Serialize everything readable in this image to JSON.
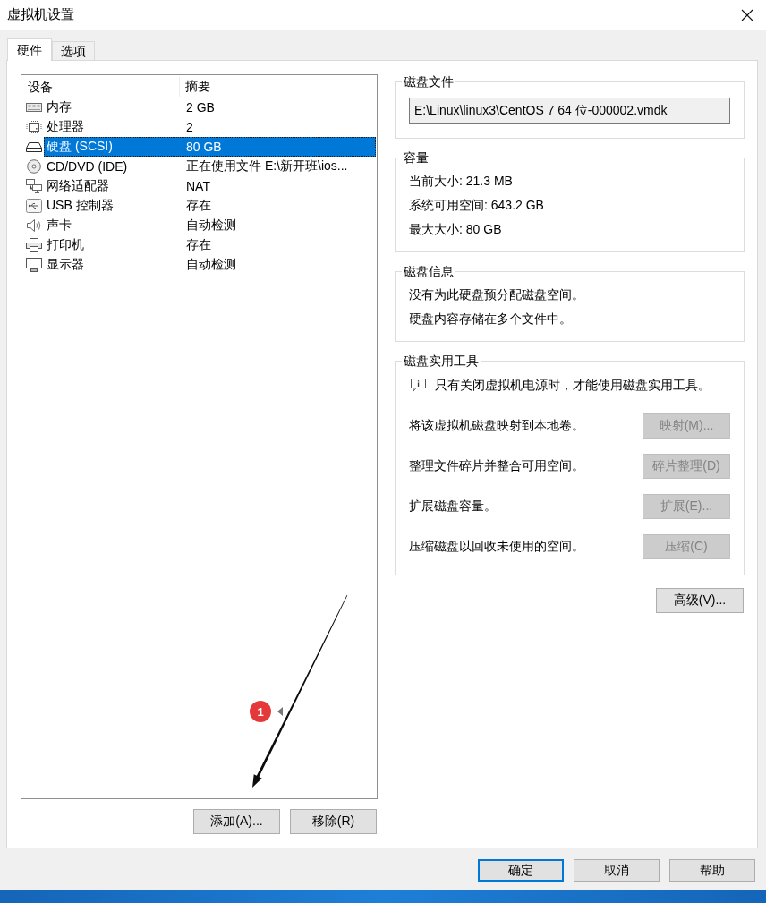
{
  "window": {
    "title": "虚拟机设置"
  },
  "tabs": [
    {
      "label": "硬件",
      "selected": true
    },
    {
      "label": "选项",
      "selected": false
    }
  ],
  "device_list": {
    "columns": [
      "设备",
      "摘要"
    ],
    "rows": [
      {
        "kind": "memory",
        "device": "内存",
        "summary": "2 GB",
        "selected": false
      },
      {
        "kind": "processor",
        "device": "处理器",
        "summary": "2",
        "selected": false
      },
      {
        "kind": "disk",
        "device": "硬盘 (SCSI)",
        "summary": "80 GB",
        "selected": true
      },
      {
        "kind": "cdrom",
        "device": "CD/DVD (IDE)",
        "summary": "正在使用文件 E:\\新开班\\ios...",
        "selected": false
      },
      {
        "kind": "network",
        "device": "网络适配器",
        "summary": "NAT",
        "selected": false
      },
      {
        "kind": "usb",
        "device": "USB 控制器",
        "summary": "存在",
        "selected": false
      },
      {
        "kind": "sound",
        "device": "声卡",
        "summary": "自动检测",
        "selected": false
      },
      {
        "kind": "printer",
        "device": "打印机",
        "summary": "存在",
        "selected": false
      },
      {
        "kind": "display",
        "device": "显示器",
        "summary": "自动检测",
        "selected": false
      }
    ]
  },
  "annotation": {
    "badge": "1"
  },
  "list_buttons": [
    "添加(A)...",
    "移除(R)"
  ],
  "disk_file": {
    "title": "磁盘文件",
    "value": "E:\\Linux\\linux3\\CentOS 7 64 位-000002.vmdk"
  },
  "capacity": {
    "title": "容量",
    "lines": [
      "当前大小: 21.3 MB",
      "系统可用空间: 643.2 GB",
      "最大大小: 80 GB"
    ]
  },
  "disk_info": {
    "title": "磁盘信息",
    "lines": [
      "没有为此硬盘预分配磁盘空间。",
      "硬盘内容存储在多个文件中。"
    ]
  },
  "disk_utilities": {
    "title": "磁盘实用工具",
    "notice": "只有关闭虚拟机电源时，才能使用磁盘实用工具。",
    "actions": [
      {
        "description": "将该虚拟机磁盘映射到本地卷。",
        "button": "映射(M)...",
        "disabled": true
      },
      {
        "description": "整理文件碎片并整合可用空间。",
        "button": "碎片整理(D)",
        "disabled": true
      },
      {
        "description": "扩展磁盘容量。",
        "button": "扩展(E)...",
        "disabled": true
      },
      {
        "description": "压缩磁盘以回收未使用的空间。",
        "button": "压缩(C)",
        "disabled": true
      }
    ]
  },
  "advanced_button": "高级(V)...",
  "dialog_buttons": [
    {
      "label": "确定",
      "default": true
    },
    {
      "label": "取消",
      "default": false
    },
    {
      "label": "帮助",
      "default": false
    }
  ]
}
